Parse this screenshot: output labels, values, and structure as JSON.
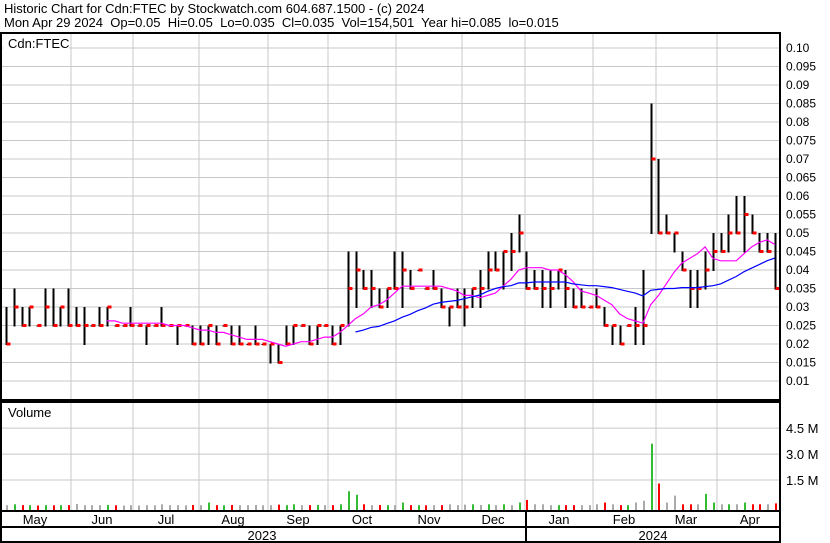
{
  "header": {
    "title": "Historic Chart for Cdn:FTEC by Stockwatch.com 604.687.1500 - (c) 2024",
    "quote": "Mon Apr 29 2024  Op=0.05  Hi=0.05  Lo=0.035  Cl=0.035  Vol=154,501  Year hi=0.085  lo=0.015"
  },
  "colors": {
    "bar": "#000000",
    "close": "#ff0000",
    "ma_short": "#ff00ff",
    "ma_long": "#0000ff",
    "vol_up": "#33bb33",
    "vol_down": "#ff0000",
    "vol_flat": "#aaaaaa",
    "grid": "#c8c8c8"
  },
  "chart_data": [
    {
      "type": "ohlc",
      "title": "Cdn:FTEC",
      "ylim": [
        0.005,
        0.105
      ],
      "yticks": [
        "0.01",
        "0.015",
        "0.02",
        "0.025",
        "0.03",
        "0.035",
        "0.04",
        "0.045",
        "0.05",
        "0.055",
        "0.06",
        "0.065",
        "0.07",
        "0.075",
        "0.08",
        "0.085",
        "0.09",
        "0.095",
        "0.10"
      ],
      "x_months": [
        "May",
        "Jun",
        "Jul",
        "Aug",
        "Sep",
        "Oct",
        "Nov",
        "Dec",
        "Jan",
        "Feb",
        "Mar",
        "Apr"
      ],
      "x_years": [
        "2023",
        "2024"
      ],
      "bars_hi_lo_close": [
        [
          0.03,
          0.02,
          0.02
        ],
        [
          0.035,
          0.025,
          0.03
        ],
        [
          0.03,
          0.025,
          0.025
        ],
        [
          0.03,
          0.025,
          0.03
        ],
        [
          0.025,
          0.025,
          0.025
        ],
        [
          0.035,
          0.025,
          0.03
        ],
        [
          0.035,
          0.025,
          0.025
        ],
        [
          0.03,
          0.025,
          0.03
        ],
        [
          0.035,
          0.025,
          0.025
        ],
        [
          0.03,
          0.025,
          0.025
        ],
        [
          0.03,
          0.02,
          0.025
        ],
        [
          0.025,
          0.025,
          0.025
        ],
        [
          0.03,
          0.025,
          0.025
        ],
        [
          0.03,
          0.025,
          0.03
        ],
        [
          0.025,
          0.025,
          0.025
        ],
        [
          0.025,
          0.025,
          0.025
        ],
        [
          0.03,
          0.025,
          0.025
        ],
        [
          0.025,
          0.025,
          0.025
        ],
        [
          0.025,
          0.02,
          0.025
        ],
        [
          0.025,
          0.025,
          0.025
        ],
        [
          0.03,
          0.025,
          0.025
        ],
        [
          0.025,
          0.025,
          0.025
        ],
        [
          0.025,
          0.02,
          0.025
        ],
        [
          0.025,
          0.025,
          0.025
        ],
        [
          0.025,
          0.02,
          0.02
        ],
        [
          0.025,
          0.02,
          0.02
        ],
        [
          0.025,
          0.02,
          0.025
        ],
        [
          0.025,
          0.02,
          0.02
        ],
        [
          0.025,
          0.025,
          0.025
        ],
        [
          0.025,
          0.02,
          0.02
        ],
        [
          0.025,
          0.02,
          0.02
        ],
        [
          0.02,
          0.02,
          0.02
        ],
        [
          0.025,
          0.02,
          0.02
        ],
        [
          0.02,
          0.02,
          0.02
        ],
        [
          0.02,
          0.015,
          0.02
        ],
        [
          0.02,
          0.015,
          0.015
        ],
        [
          0.025,
          0.02,
          0.02
        ],
        [
          0.025,
          0.02,
          0.025
        ],
        [
          0.025,
          0.025,
          0.025
        ],
        [
          0.025,
          0.02,
          0.02
        ],
        [
          0.025,
          0.02,
          0.025
        ],
        [
          0.025,
          0.025,
          0.025
        ],
        [
          0.025,
          0.02,
          0.02
        ],
        [
          0.025,
          0.02,
          0.025
        ],
        [
          0.045,
          0.025,
          0.035
        ],
        [
          0.045,
          0.03,
          0.04
        ],
        [
          0.04,
          0.035,
          0.035
        ],
        [
          0.04,
          0.03,
          0.035
        ],
        [
          0.035,
          0.03,
          0.03
        ],
        [
          0.035,
          0.03,
          0.035
        ],
        [
          0.045,
          0.035,
          0.035
        ],
        [
          0.045,
          0.03,
          0.04
        ],
        [
          0.04,
          0.035,
          0.035
        ],
        [
          0.04,
          0.04,
          0.04
        ],
        [
          0.035,
          0.035,
          0.035
        ],
        [
          0.04,
          0.035,
          0.035
        ],
        [
          0.035,
          0.03,
          0.03
        ],
        [
          0.03,
          0.025,
          0.03
        ],
        [
          0.035,
          0.03,
          0.03
        ],
        [
          0.035,
          0.025,
          0.03
        ],
        [
          0.035,
          0.03,
          0.035
        ],
        [
          0.04,
          0.03,
          0.035
        ],
        [
          0.045,
          0.035,
          0.04
        ],
        [
          0.045,
          0.04,
          0.04
        ],
        [
          0.045,
          0.035,
          0.045
        ],
        [
          0.05,
          0.04,
          0.045
        ],
        [
          0.055,
          0.045,
          0.05
        ],
        [
          0.045,
          0.035,
          0.035
        ],
        [
          0.04,
          0.035,
          0.035
        ],
        [
          0.04,
          0.03,
          0.035
        ],
        [
          0.04,
          0.03,
          0.035
        ],
        [
          0.04,
          0.035,
          0.04
        ],
        [
          0.04,
          0.03,
          0.035
        ],
        [
          0.035,
          0.03,
          0.03
        ],
        [
          0.035,
          0.03,
          0.03
        ],
        [
          0.03,
          0.03,
          0.03
        ],
        [
          0.035,
          0.03,
          0.03
        ],
        [
          0.03,
          0.025,
          0.025
        ],
        [
          0.025,
          0.02,
          0.025
        ],
        [
          0.025,
          0.02,
          0.02
        ],
        [
          0.025,
          0.025,
          0.025
        ],
        [
          0.03,
          0.02,
          0.025
        ],
        [
          0.04,
          0.02,
          0.025
        ],
        [
          0.085,
          0.05,
          0.07
        ],
        [
          0.07,
          0.05,
          0.05
        ],
        [
          0.055,
          0.05,
          0.05
        ],
        [
          0.05,
          0.045,
          0.05
        ],
        [
          0.045,
          0.04,
          0.04
        ],
        [
          0.04,
          0.03,
          0.035
        ],
        [
          0.04,
          0.03,
          0.035
        ],
        [
          0.045,
          0.035,
          0.04
        ],
        [
          0.05,
          0.04,
          0.045
        ],
        [
          0.05,
          0.045,
          0.045
        ],
        [
          0.055,
          0.045,
          0.05
        ],
        [
          0.06,
          0.05,
          0.05
        ],
        [
          0.06,
          0.045,
          0.055
        ],
        [
          0.055,
          0.05,
          0.05
        ],
        [
          0.05,
          0.045,
          0.045
        ],
        [
          0.05,
          0.045,
          0.045
        ],
        [
          0.05,
          0.035,
          0.035
        ]
      ]
    },
    {
      "type": "bar",
      "title": "Volume",
      "ylim_millions": [
        0,
        6
      ],
      "yticks": [
        "1.5 M",
        "3.0 M",
        "4.5 M"
      ],
      "ytick_values": [
        1.5,
        3.0,
        4.5
      ],
      "volume_millions": [
        0.05,
        0.1,
        0.05,
        0.05,
        0.03,
        0.05,
        0.04,
        0.05,
        0.05,
        0.12,
        0.05,
        0.05,
        0.05,
        0.06,
        0.04,
        0.03,
        0.05,
        0.03,
        0.05,
        0.04,
        0.1,
        0.05,
        0.05,
        0.04,
        0.06,
        0.05,
        0.2,
        0.05,
        0.04,
        0.06,
        0.05,
        0.05,
        0.06,
        0.04,
        0.05,
        0.08,
        0.05,
        0.1,
        0.05,
        0.05,
        0.06,
        0.05,
        0.05,
        0.1,
        0.85,
        0.65,
        0.1,
        0.05,
        0.06,
        0.05,
        0.05,
        0.2,
        0.05,
        0.05,
        0.04,
        0.05,
        0.05,
        0.1,
        0.05,
        0.08,
        0.1,
        0.06,
        0.1,
        0.05,
        0.1,
        0.05,
        0.2,
        0.35,
        0.1,
        0.1,
        0.05,
        0.05,
        0.05,
        0.05,
        0.05,
        0.05,
        0.1,
        0.2,
        0.1,
        0.05,
        0.05,
        0.2,
        0.3,
        3.6,
        1.3,
        0.2,
        0.6,
        0.1,
        0.1,
        0.1,
        0.7,
        0.2,
        0.1,
        0.1,
        0.1,
        0.2,
        0.1,
        0.1,
        0.1,
        0.15
      ]
    }
  ]
}
